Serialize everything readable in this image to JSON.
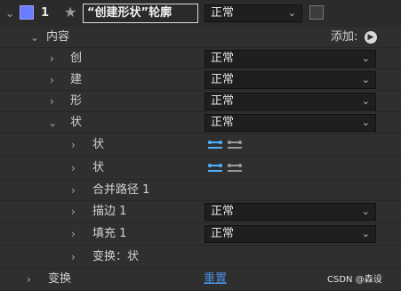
{
  "layer": {
    "number": "1",
    "name": "“创建形状”轮廓",
    "mode": "正常",
    "chevron": "chevron-down"
  },
  "contents": {
    "label": "内容",
    "add_label": "添加:",
    "add_icon": "play-circle-icon"
  },
  "groups": [
    {
      "label": "创",
      "blend": "正常"
    },
    {
      "label": "建",
      "blend": "正常"
    },
    {
      "label": "形",
      "blend": "正常"
    },
    {
      "label": "状",
      "blend": "正常"
    }
  ],
  "sub_items": [
    {
      "label": "状"
    },
    {
      "label": "状"
    },
    {
      "label": "合并路径 1"
    },
    {
      "label": "描边 1",
      "blend": "正常"
    },
    {
      "label": "填充 1",
      "blend": "正常"
    },
    {
      "label": "变换：状"
    }
  ],
  "transform": {
    "label": "变换",
    "reset": "重置"
  },
  "watermark": "CSDN @森设",
  "colors": {
    "label_swatch": "#6a7bff",
    "accent_link": "#4a90e2",
    "path_icon": "#4fb0ff"
  }
}
